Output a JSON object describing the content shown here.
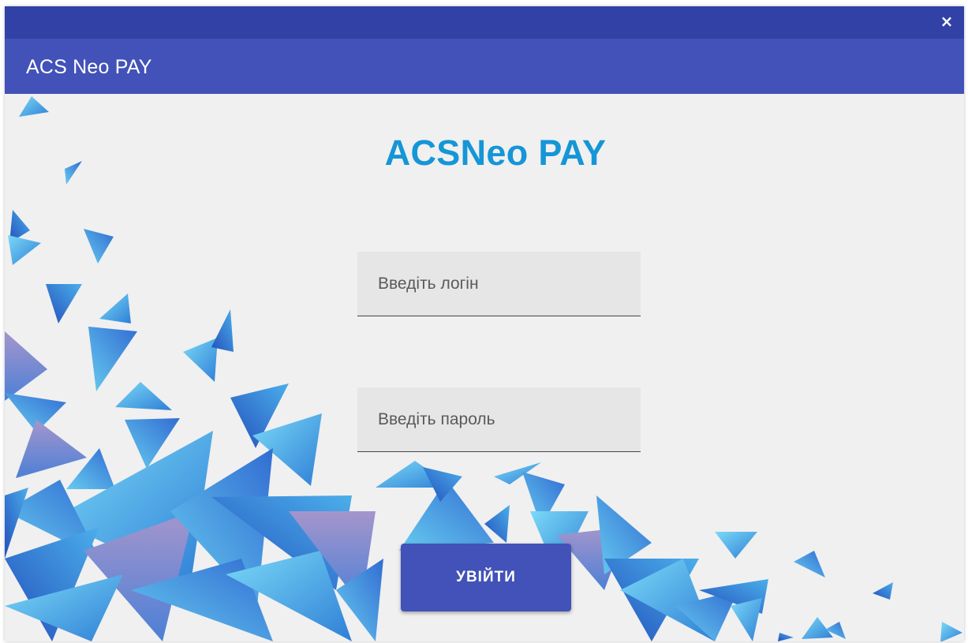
{
  "window": {
    "close_glyph": "✕",
    "app_title": "ACS Neo PAY"
  },
  "login": {
    "brand": "ACSNeo PAY",
    "login_placeholder": "Введіть логін",
    "password_placeholder": "Введіть пароль",
    "submit_label": "УВІЙТИ"
  },
  "colors": {
    "titlebar": "#3141a6",
    "appbar": "#4252b8",
    "brand": "#1596d6",
    "background": "#f0f0f0"
  },
  "icons": {
    "close": "close-icon"
  }
}
